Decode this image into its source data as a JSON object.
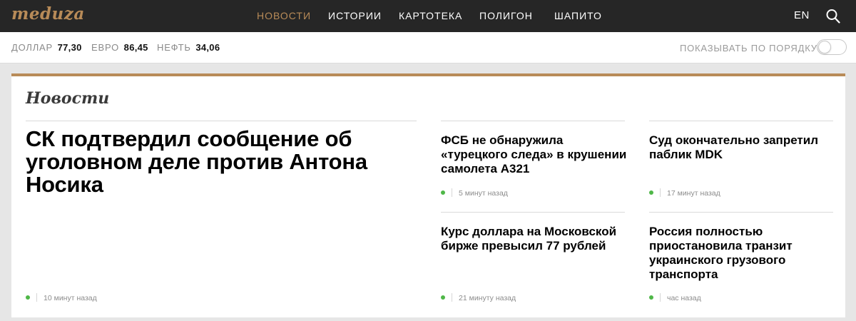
{
  "header": {
    "logo": "meduza",
    "nav": [
      {
        "label": "НОВОСТИ",
        "active": true
      },
      {
        "label": "ИСТОРИИ",
        "active": false
      },
      {
        "label": "КАРТОТЕКА",
        "active": false
      },
      {
        "label": "ПОЛИГОН",
        "active": false
      },
      {
        "label": "ШАПИТО",
        "active": false
      }
    ],
    "lang": "EN",
    "search_icon": "search-icon"
  },
  "ticker": {
    "rates": [
      {
        "label": "ДОЛЛАР",
        "value": "77,30"
      },
      {
        "label": "ЕВРО",
        "value": "86,45"
      },
      {
        "label": "НЕФТЬ",
        "value": "34,06"
      }
    ],
    "order_label": "ПОКАЗЫВАТЬ ПО ПОРЯДКУ",
    "order_toggle_on": false
  },
  "section": {
    "title": "Новости",
    "main": {
      "headline": "СК подтвердил сообщение об уголовном деле против Антона Носика",
      "time": "10 минут назад"
    },
    "items": [
      {
        "headline": "ФСБ не обнаружила «турецкого следа» в крушении самолета А321",
        "time": "5 минут назад"
      },
      {
        "headline": "Суд окончательно запретил паблик MDK",
        "time": "17 минут назад"
      },
      {
        "headline": "Курс доллара на Московской бирже превысил 77 рублей",
        "time": "21 минуту назад"
      },
      {
        "headline": "Россия полностью приостановила транзит украинского грузового транспорта",
        "time": "час назад"
      }
    ]
  },
  "colors": {
    "accent": "#b88b58",
    "topbar": "#262626",
    "fresh_dot": "#4fb748"
  }
}
